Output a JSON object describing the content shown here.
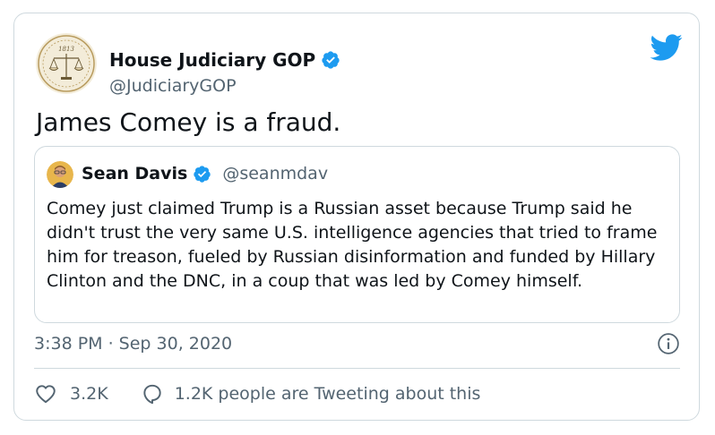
{
  "author": {
    "name": "House Judiciary GOP",
    "handle": "@JudiciaryGOP",
    "verified": true,
    "avatar_icon": "scales-of-justice-seal"
  },
  "tweet": {
    "text": "James Comey is a fraud.",
    "timestamp": "3:38 PM · Sep 30, 2020"
  },
  "quoted_tweet": {
    "name": "Sean Davis",
    "handle": "@seanmdav",
    "verified": true,
    "text": "Comey just claimed Trump is a Russian asset because Trump said he didn't trust the very same U.S. intelligence agencies that tried to frame him for treason, fueled by Russian disinformation and funded by Hillary Clinton and the DNC, in a coup that was led by Comey himself."
  },
  "actions": {
    "like_count": "3.2K",
    "reply_label": "1.2K people are Tweeting about this"
  },
  "colors": {
    "twitter_blue": "#1d9bf0",
    "secondary_text": "#536471",
    "border": "#cfd9de"
  },
  "icons": {
    "brand": "twitter-bird-icon",
    "info": "info-icon",
    "like": "heart-icon",
    "reply": "speech-bubble-icon"
  }
}
